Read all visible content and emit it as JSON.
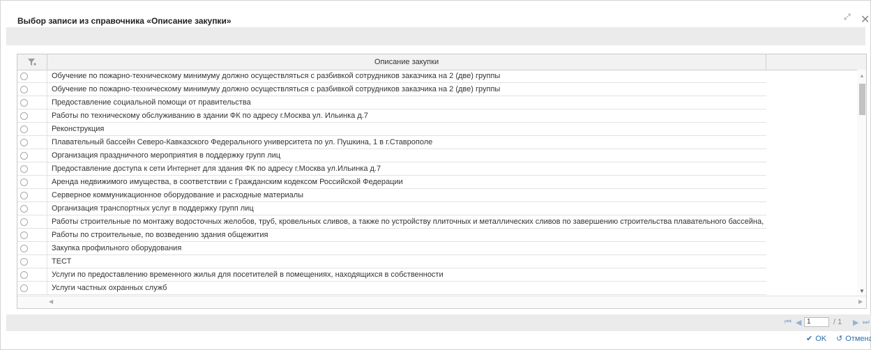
{
  "dialog": {
    "title": "Выбор записи из справочника «Описание закупки»",
    "maximize_icon": "⤢",
    "close_icon": "✕"
  },
  "grid": {
    "column_header": "Описание закупки",
    "rows": [
      "Обучение по пожарно-техническому минимуму должно осуществляться с разбивкой сотрудников заказчика на 2 (две) группы",
      "Обучение по пожарно-техническому минимуму должно осуществляться с разбивкой сотрудников заказчика на 2 (две) группы",
      "Предоставление социальной помощи от правительства",
      "Работы по техническому обслуживанию в здании ФК по адресу г.Москва ул. Ильинка д.7",
      "Реконструкция",
      "Плавательный бассейн Северо-Кавказского Федерального университета по ул. Пушкина, 1 в г.Ставрополе",
      "Организация праздничного мероприятия в поддержку групп лиц",
      "Предоставление доступа к сети Интернет для здания ФК по адресу г.Москва ул.Ильинка д.7",
      "Аренда недвижимого имущества, в соответствии с Гражданским кодексом Российской Федерации",
      "Серверное коммуникационное оборудование и расходные материалы",
      "Организация транспортных услуг в поддержку групп лиц",
      "Работы строительные по монтажу водосточных желобов, труб, кровельных сливов, а также по устройству плиточных и металлических сливов по завершению строительства плавательного бассейна, из м",
      "Работы по строительные, по возведению здания общежития",
      "Закупка профильного оборудования",
      "ТЕСТ",
      "Услуги по предоставлению временного жилья для посетителей в помещениях, находящихся в собственности",
      "Услуги частных охранных служб"
    ]
  },
  "pager": {
    "first": "⏮",
    "prev": "◀",
    "page": "1",
    "total": "/ 1",
    "next": "▶",
    "last": "⏭"
  },
  "buttons": {
    "ok_icon": "✔",
    "ok_label": "OK",
    "cancel_icon": "↺",
    "cancel_label": "Отмена"
  },
  "colors": {
    "accent": "#2f6fad",
    "pager_icon": "#8fb4d9"
  }
}
